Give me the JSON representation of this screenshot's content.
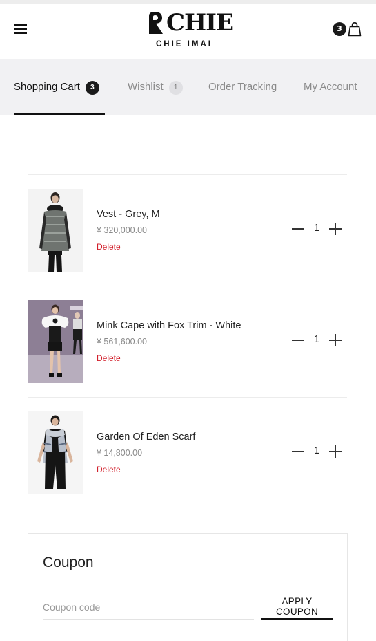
{
  "header": {
    "logo_word": "CHIE",
    "logo_sub": "CHIE IMAI",
    "cart_count": "3",
    "menu_icon": "hamburger-menu-icon",
    "bag_icon": "shopping-bag-icon"
  },
  "tabs": [
    {
      "label": "Shopping Cart",
      "badge": "3",
      "active": true
    },
    {
      "label": "Wishlist",
      "badge": "1",
      "active": false
    },
    {
      "label": "Order Tracking",
      "active": false
    },
    {
      "label": "My Account",
      "active": false
    }
  ],
  "cart": {
    "items": [
      {
        "name": "Vest - Grey, M",
        "price": "¥ 320,000.00",
        "delete_label": "Delete",
        "quantity": "1"
      },
      {
        "name": "Mink Cape with Fox Trim - White",
        "price": "¥ 561,600.00",
        "delete_label": "Delete",
        "quantity": "1"
      },
      {
        "name": "Garden Of Eden Scarf",
        "price": "¥ 14,800.00",
        "delete_label": "Delete",
        "quantity": "1"
      }
    ]
  },
  "coupon": {
    "title": "Coupon",
    "placeholder": "Coupon code",
    "apply_label": "APPLY COUPON"
  },
  "colors": {
    "accent_dark": "#1a1a1a",
    "delete_red": "#d21f2b",
    "tab_bar_bg": "#f1f1f3"
  }
}
